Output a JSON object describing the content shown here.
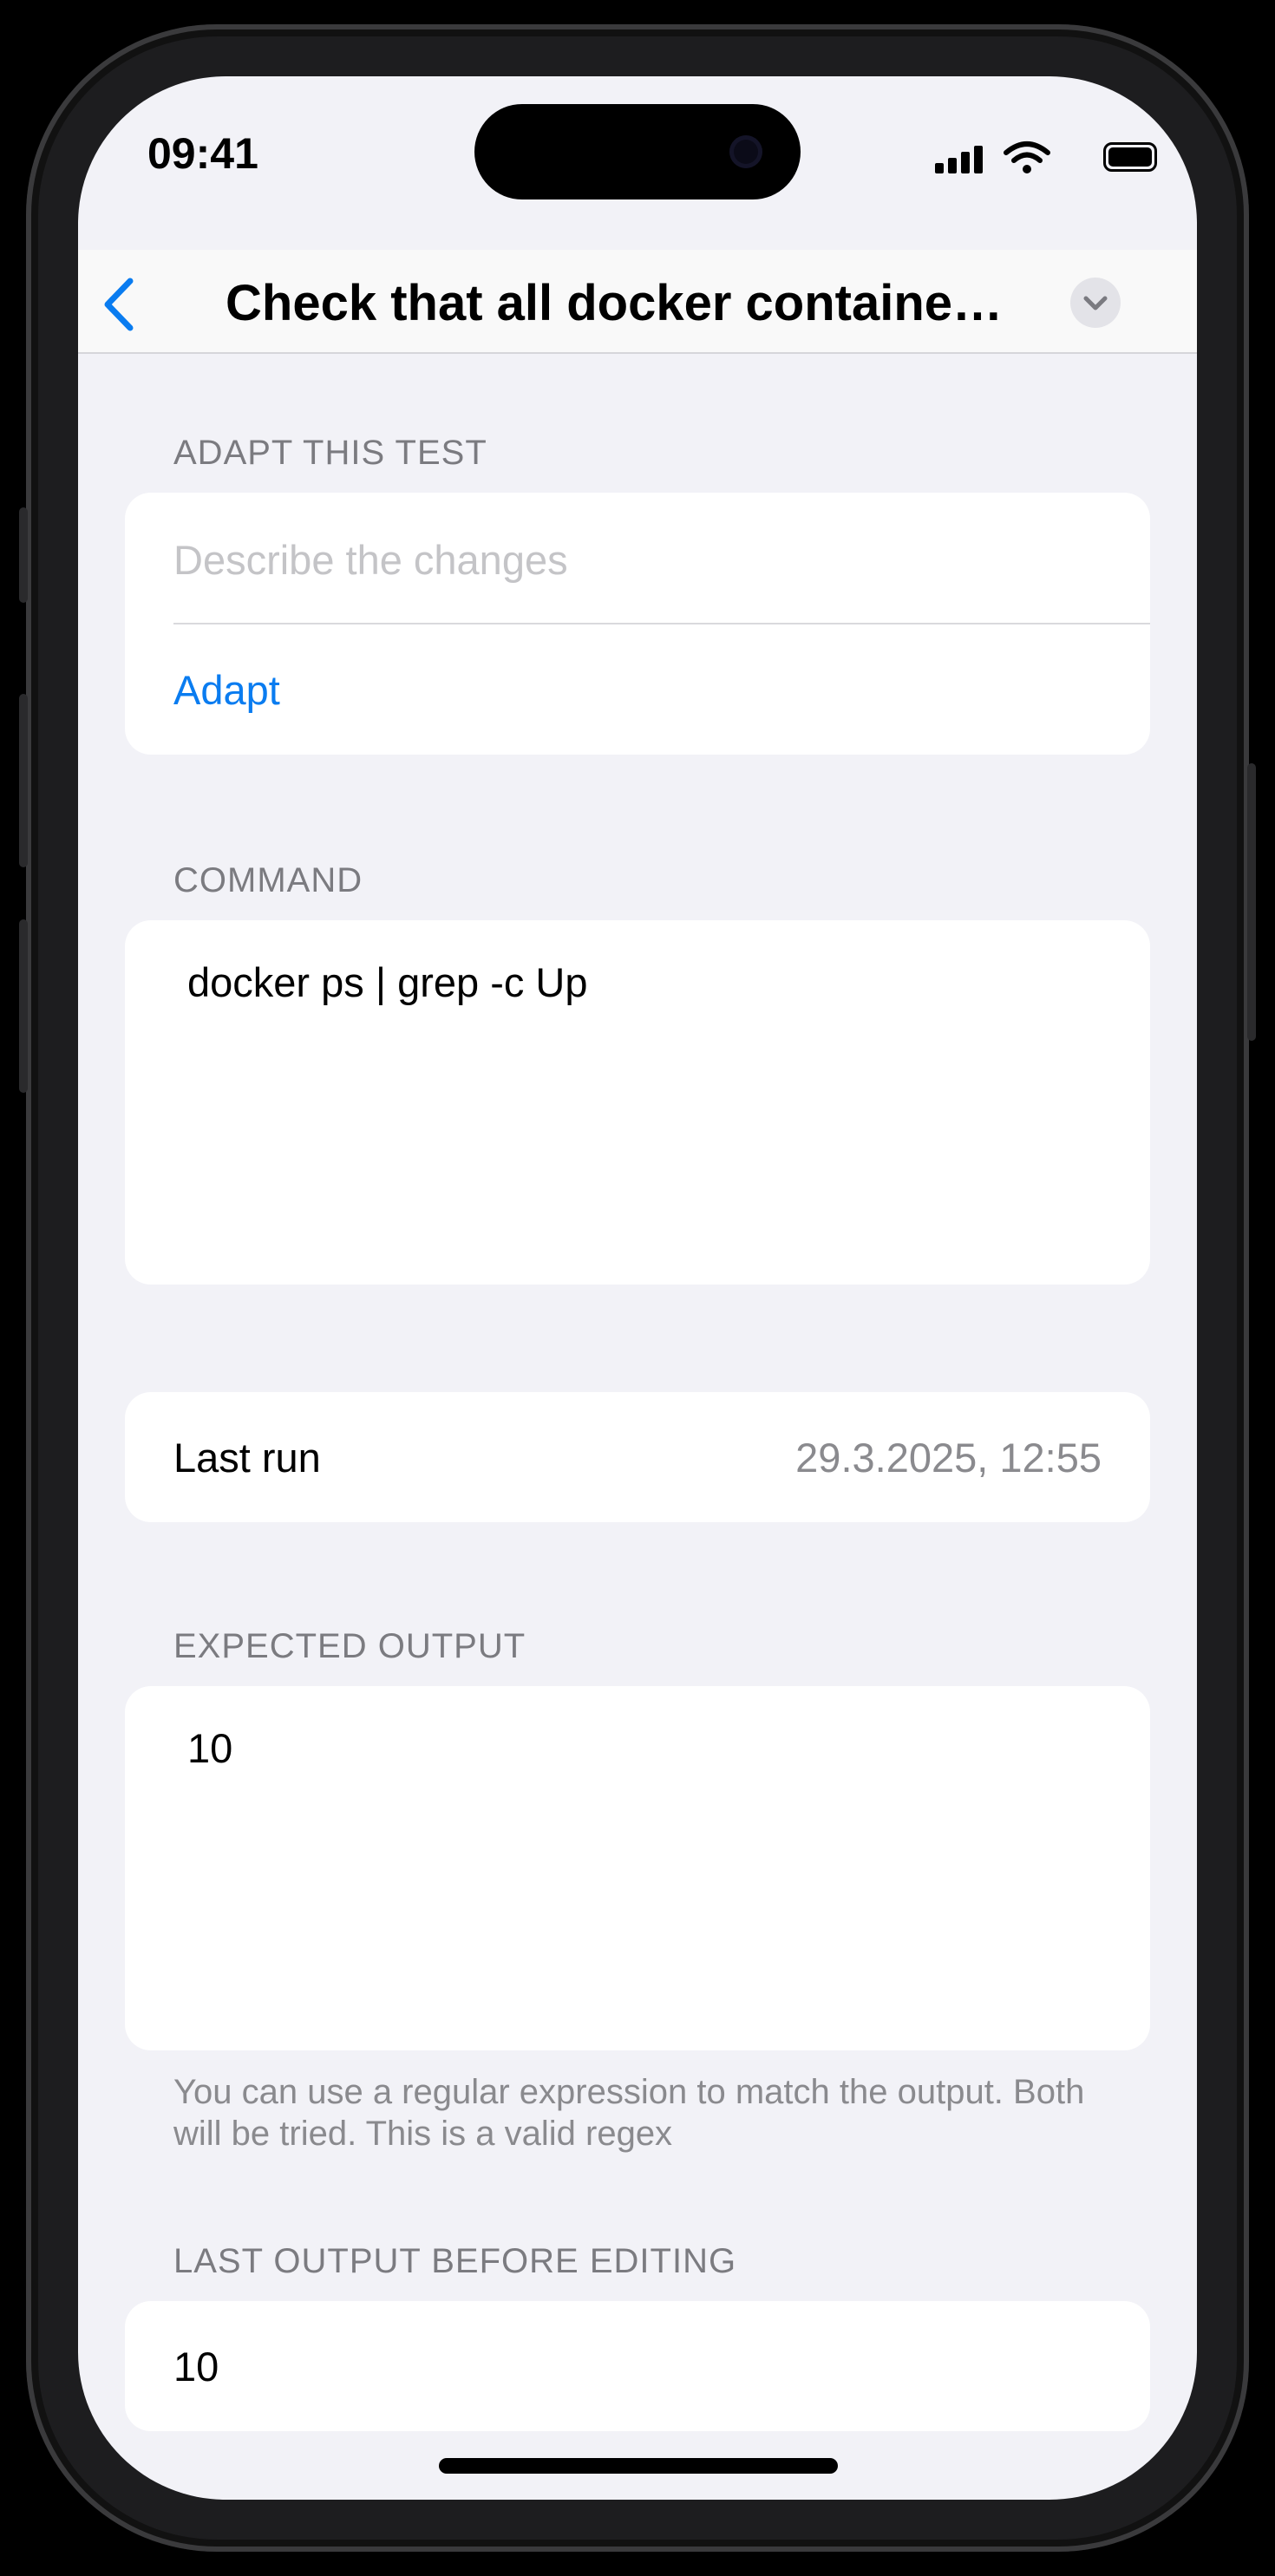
{
  "status_bar": {
    "time": "09:41",
    "icons": [
      "cellular-signal-icon",
      "wifi-icon",
      "battery-icon"
    ]
  },
  "nav": {
    "title": "Check that all docker containers...",
    "back_icon": "chevron-left-icon",
    "menu_icon": "chevron-down-icon"
  },
  "adapt_section": {
    "header": "ADAPT THIS TEST",
    "placeholder": "Describe the changes",
    "action_label": "Adapt"
  },
  "command_section": {
    "header": "COMMAND",
    "value": "docker ps | grep -c Up"
  },
  "last_run": {
    "label": "Last run",
    "value": "29.3.2025, 12:55"
  },
  "expected_output_section": {
    "header": "EXPECTED OUTPUT",
    "value": "10",
    "footer": "You can use a regular expression to match the output. Both will be tried. This is a valid regex"
  },
  "last_output_section": {
    "header": "LAST OUTPUT BEFORE EDITING",
    "value": "10"
  },
  "colors": {
    "accent": "#0a7cf0",
    "background": "#f2f2f7",
    "card": "#ffffff",
    "secondary_text": "#8a8a8e"
  }
}
